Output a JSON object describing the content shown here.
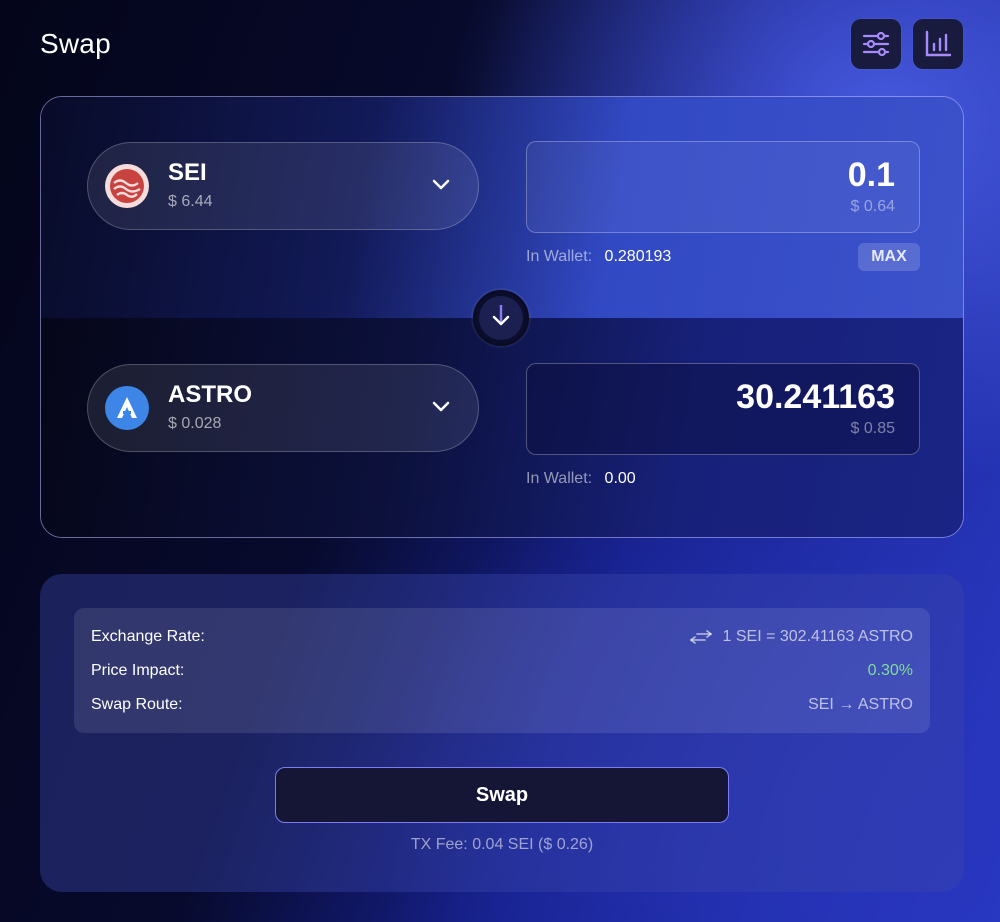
{
  "page": {
    "title": "Swap"
  },
  "toolbar": {
    "settings_icon": "sliders-icon",
    "chart_icon": "bar-chart-icon"
  },
  "from": {
    "symbol": "SEI",
    "price": "$ 6.44",
    "amount": "0.1",
    "amount_usd": "$ 0.64",
    "wallet_label": "In Wallet:",
    "wallet_value": "0.280193",
    "max_label": "MAX",
    "logo_color": "#c8423f"
  },
  "to": {
    "symbol": "ASTRO",
    "price": "$ 0.028",
    "amount": "30.241163",
    "amount_usd": "$ 0.85",
    "wallet_label": "In Wallet:",
    "wallet_value": "0.00",
    "logo_color": "#3d86e8"
  },
  "info": {
    "exchange_rate_label": "Exchange Rate:",
    "exchange_rate_value": "1 SEI = 302.41163 ASTRO",
    "price_impact_label": "Price Impact:",
    "price_impact_value": "0.30%",
    "swap_route_label": "Swap Route:",
    "swap_route_value": "SEI → ASTRO"
  },
  "actions": {
    "swap_label": "Swap",
    "tx_fee": "TX Fee: 0.04 SEI ($ 0.26)"
  },
  "colors": {
    "accent": "#7a7cf0",
    "positive": "#7fdc9a"
  }
}
